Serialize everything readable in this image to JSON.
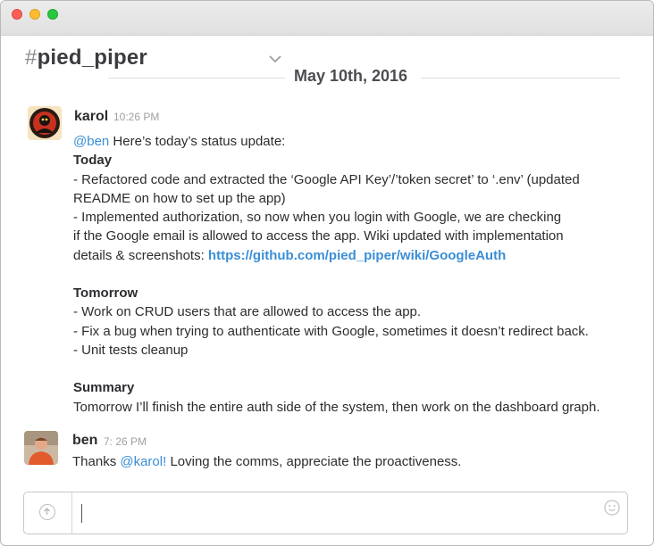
{
  "channel": {
    "hash": "#",
    "name": "pied_piper"
  },
  "date_divider": "May 10th, 2016",
  "messages": [
    {
      "sender": "karol",
      "time": "10:26 PM",
      "intro_mention": "@ben",
      "intro_text": " Here’s today’s status update:",
      "today_heading": "Today",
      "today_lines": [
        "- Refactored code and extracted the ‘Google API Key’/’token secret’ to ‘.env’ (updated",
        "README on how to set up the app)",
        "- Implemented authorization, so now when you login with Google, we are checking",
        "if the Google email is allowed to access the app. Wiki updated with implementation"
      ],
      "details_text": "details & screenshots: ",
      "link": "https://github.com/pied_piper/wiki/GoogleAuth",
      "tomorrow_heading": "Tomorrow",
      "tomorrow_lines": [
        "- Work on CRUD users that are allowed to access the app.",
        "- Fix a bug when trying to authenticate with Google, sometimes it doesn’t redirect back.",
        "- Unit tests cleanup"
      ],
      "summary_heading": "Summary",
      "summary_text": "Tomorrow I’ll finish the entire auth side of the system, then work on the dashboard graph."
    },
    {
      "sender": "ben",
      "time": "7: 26 PM",
      "text_before": "Thanks ",
      "mention": "@karol!",
      "text_after": " Loving the comms, appreciate the proactiveness."
    }
  ],
  "composer": {
    "value": ""
  },
  "colors": {
    "accent_link": "#3a8ed6",
    "traffic_red": "#fc5f57",
    "traffic_yellow": "#fdbc2e",
    "traffic_green": "#28c840"
  },
  "icons": {
    "channel_menu": "chevron-down-icon",
    "upload": "upload-arrow-icon",
    "emoji": "emoji-icon"
  }
}
